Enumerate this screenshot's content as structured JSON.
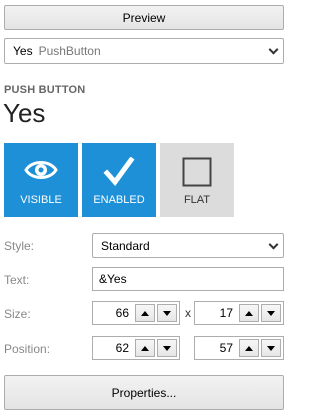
{
  "preview_label": "Preview",
  "control_select": {
    "value": "Yes",
    "type": "PushButton"
  },
  "header": {
    "control_type": "PUSH BUTTON",
    "control_name": "Yes"
  },
  "tiles": [
    {
      "label": "VISIBLE",
      "state": "on",
      "icon": "eye-icon"
    },
    {
      "label": "ENABLED",
      "state": "on",
      "icon": "checkmark-icon"
    },
    {
      "label": "FLAT",
      "state": "off",
      "icon": "square-icon"
    }
  ],
  "colors": {
    "tile_on": "#1e90d8",
    "tile_off": "#dcdcdc"
  },
  "form": {
    "style_label": "Style:",
    "style_value": "Standard",
    "text_label": "Text:",
    "text_value": "&Yes",
    "size_label": "Size:",
    "size_width": "66",
    "size_separator": "x",
    "size_height": "17",
    "position_label": "Position:",
    "position_x": "62",
    "position_y": "57"
  },
  "properties_label": "Properties..."
}
